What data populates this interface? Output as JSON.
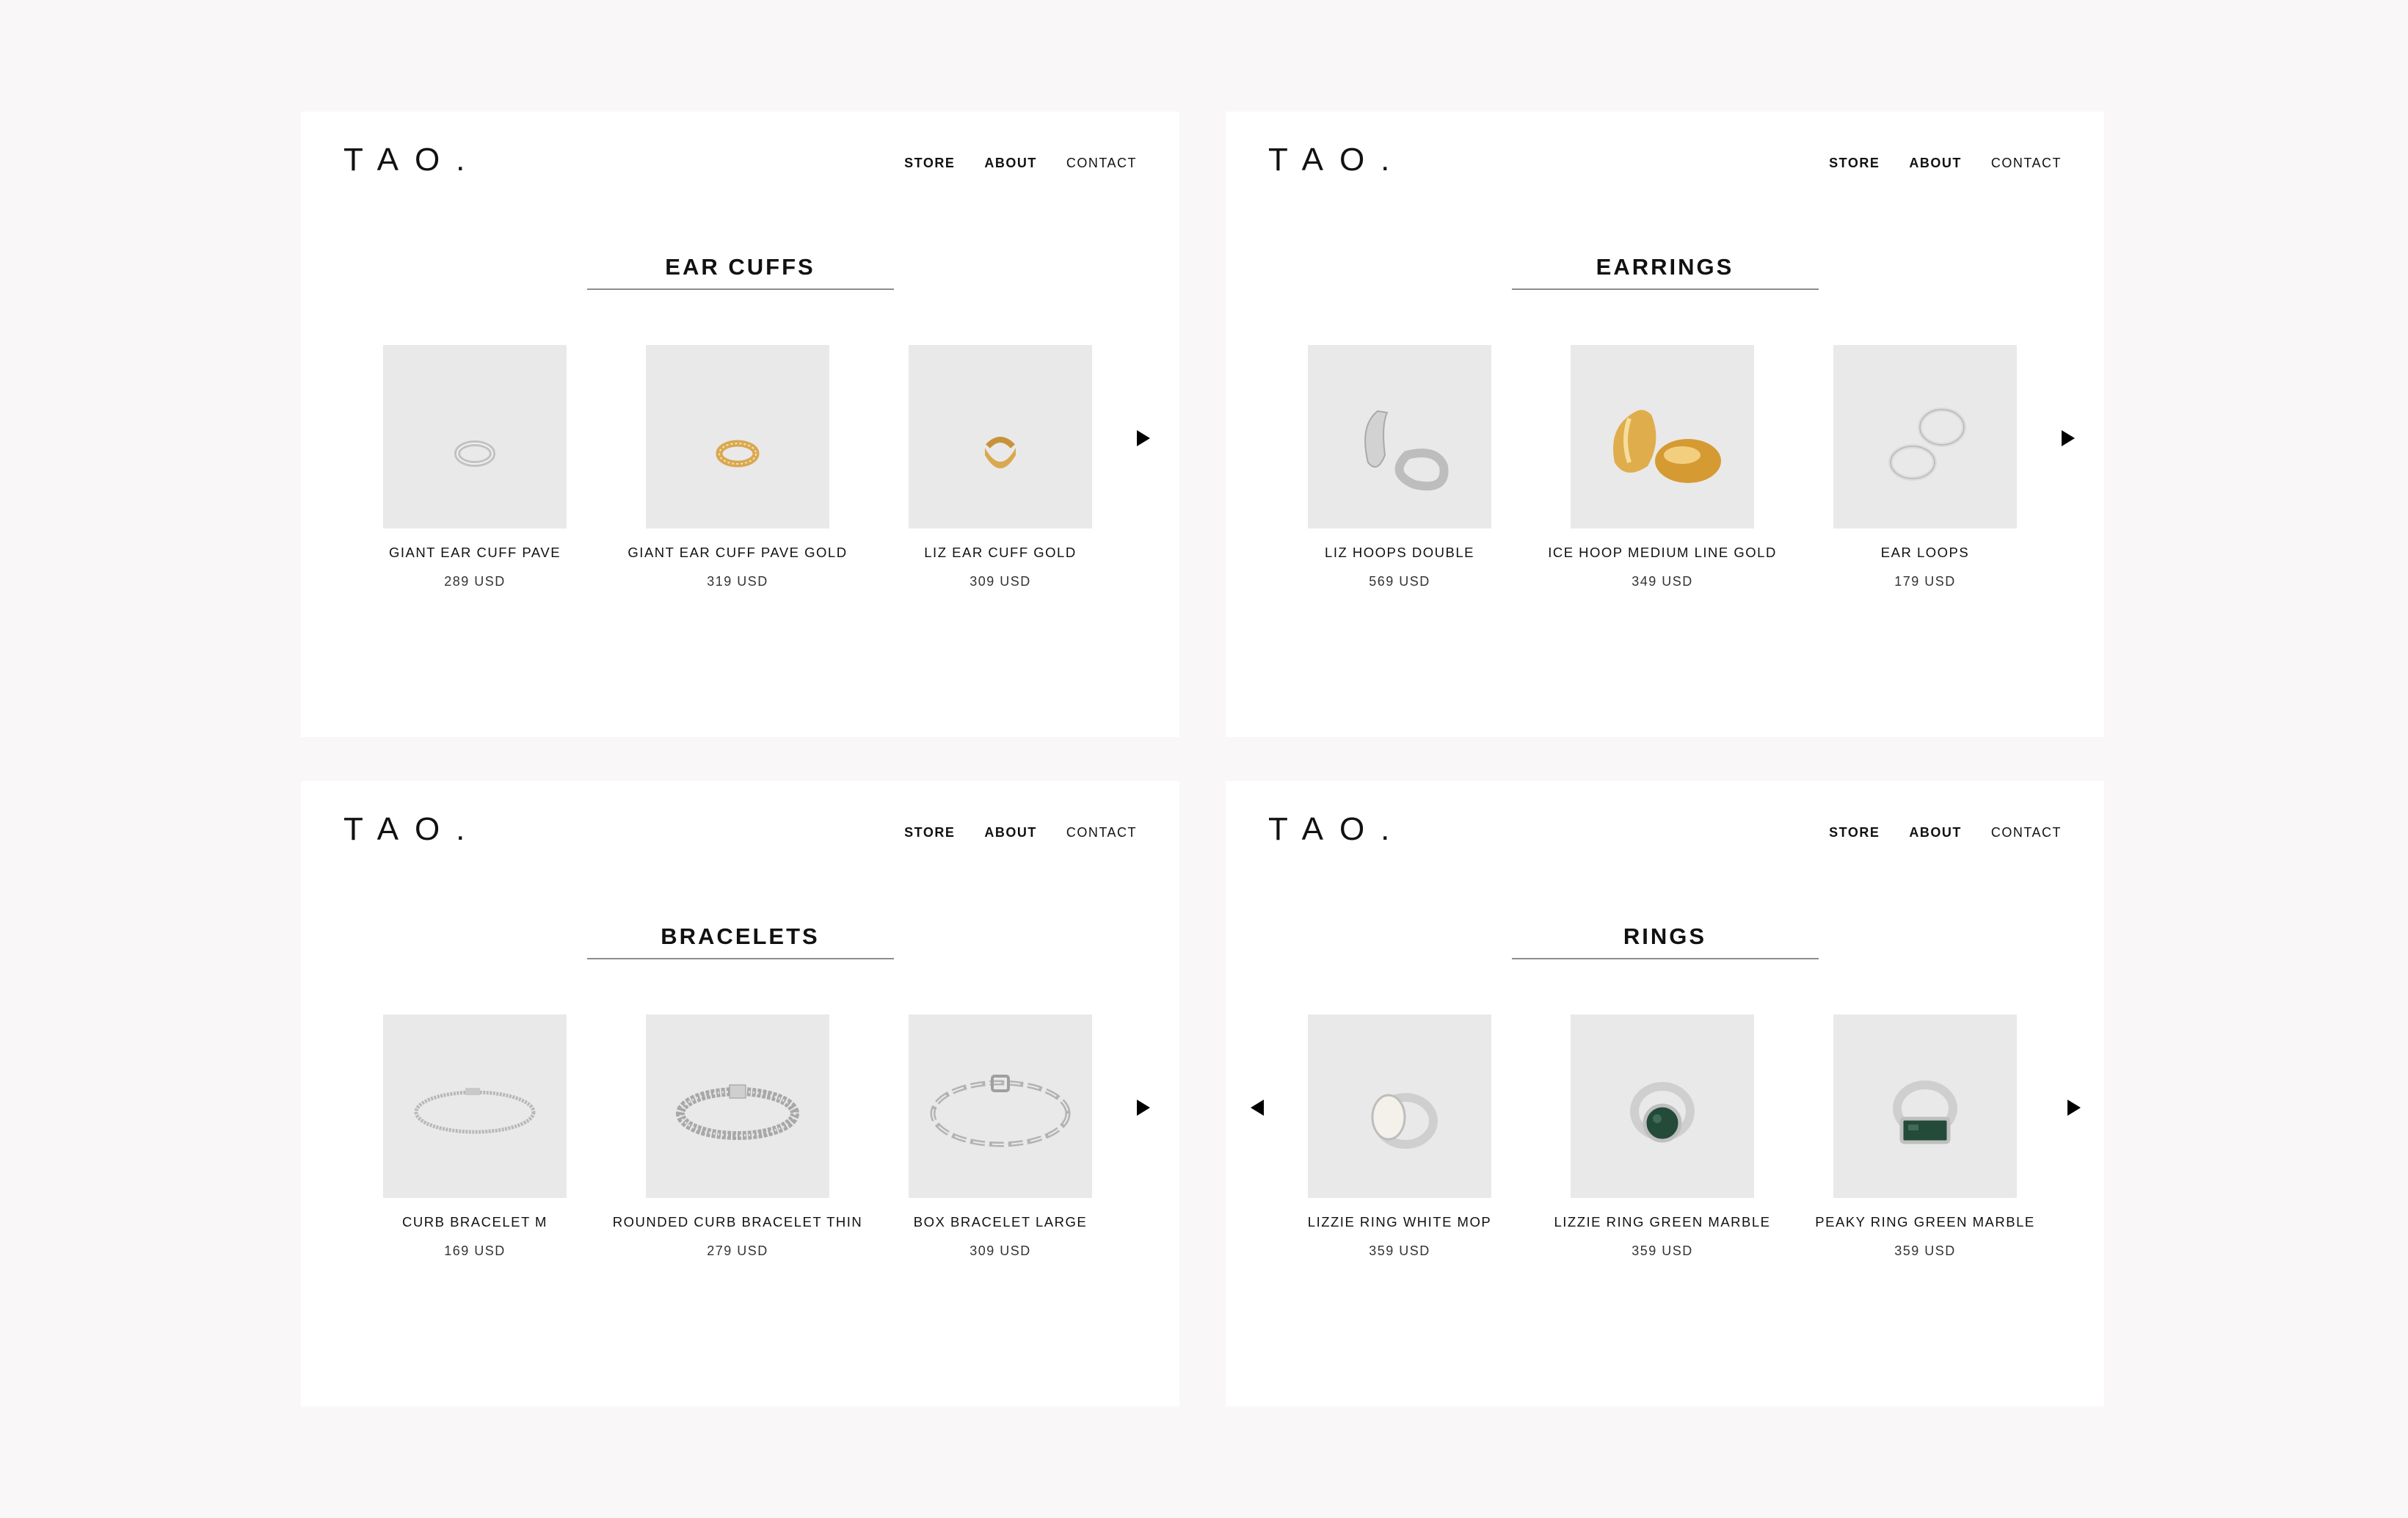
{
  "brand": "TAO.",
  "nav": {
    "store": "STORE",
    "about": "ABOUT",
    "contact": "CONTACT"
  },
  "panels": [
    {
      "title": "EAR CUFFS",
      "products": [
        {
          "name": "GIANT EAR CUFF PAVE",
          "price": "289 USD",
          "image": "silver-ear-cuff"
        },
        {
          "name": "GIANT EAR CUFF PAVE GOLD",
          "price": "319 USD",
          "image": "gold-ear-cuff-pave"
        },
        {
          "name": "LIZ EAR CUFF GOLD",
          "price": "309 USD",
          "image": "gold-ear-cuff"
        }
      ]
    },
    {
      "title": "EARRINGS",
      "products": [
        {
          "name": "LIZ HOOPS DOUBLE",
          "price": "569 USD",
          "image": "silver-hoops"
        },
        {
          "name": "ICE HOOP MEDIUM LINE GOLD",
          "price": "349 USD",
          "image": "gold-hoops"
        },
        {
          "name": "EAR LOOPS",
          "price": "179 USD",
          "image": "silver-loops"
        }
      ]
    },
    {
      "title": "BRACELETS",
      "products": [
        {
          "name": "CURB BRACELET M",
          "price": "169 USD",
          "image": "curb-bracelet"
        },
        {
          "name": "ROUNDED CURB BRACELET THIN",
          "price": "279 USD",
          "image": "rounded-curb-bracelet"
        },
        {
          "name": "BOX BRACELET LARGE",
          "price": "309 USD",
          "image": "box-bracelet"
        }
      ]
    },
    {
      "title": "RINGS",
      "products": [
        {
          "name": "LIZZIE RING WHITE MOP",
          "price": "359 USD",
          "image": "white-signet-ring"
        },
        {
          "name": "LIZZIE RING GREEN MARBLE",
          "price": "359 USD",
          "image": "green-round-signet-ring"
        },
        {
          "name": "PEAKY RING GREEN MARBLE",
          "price": "359 USD",
          "image": "green-rect-signet-ring"
        }
      ]
    }
  ],
  "colors": {
    "background": "#f9f7f7",
    "panel": "#ffffff",
    "thumb": "#e9e9e9",
    "silver": "#c9c9c9",
    "gold": "#d9a850",
    "green_marble": "#244a3a"
  },
  "icons": {
    "next": "next-arrow-icon",
    "prev": "prev-arrow-icon"
  }
}
